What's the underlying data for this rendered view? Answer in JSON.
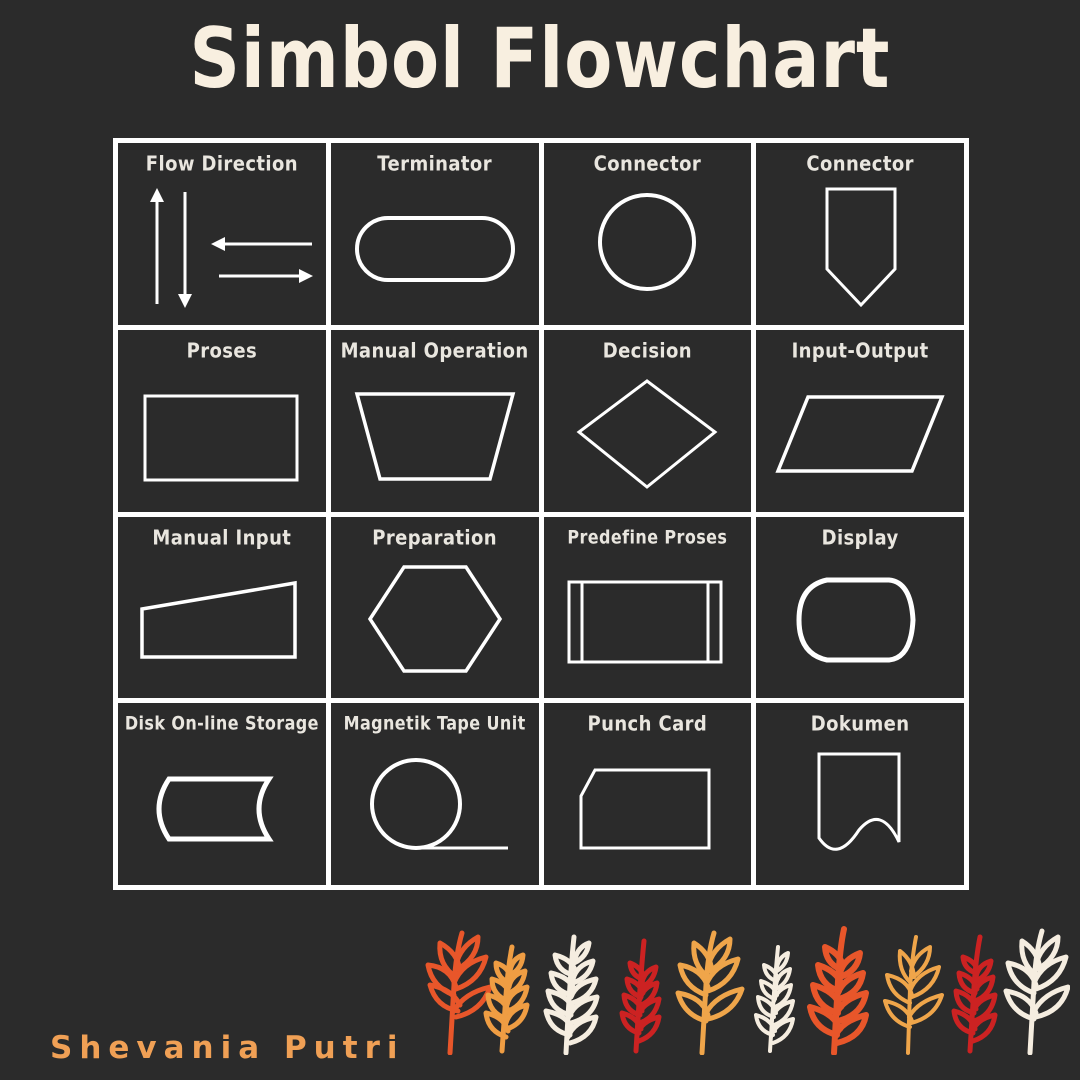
{
  "poster": {
    "title": "Simbol Flowchart",
    "signature": "Shevania Putri",
    "background_color": "#2b2b2b",
    "title_color": "#f8efe0",
    "stroke_color": "#ffffff",
    "label_color": "#e9e6df",
    "signature_color": "#f0a055"
  },
  "grid": {
    "rows": 4,
    "columns": 4,
    "cells": [
      {
        "label": "Flow Direction",
        "symbol": "flow-direction-arrows"
      },
      {
        "label": "Terminator",
        "symbol": "stadium-rounded-rectangle"
      },
      {
        "label": "Connector",
        "symbol": "circle"
      },
      {
        "label": "Connector",
        "symbol": "off-page-connector-pentagon"
      },
      {
        "label": "Proses",
        "symbol": "rectangle"
      },
      {
        "label": "Manual Operation",
        "symbol": "inverted-trapezoid"
      },
      {
        "label": "Decision",
        "symbol": "diamond"
      },
      {
        "label": "Input-Output",
        "symbol": "parallelogram"
      },
      {
        "label": "Manual Input",
        "symbol": "slanted-top-quadrilateral"
      },
      {
        "label": "Preparation",
        "symbol": "hexagon"
      },
      {
        "label": "Predefine Proses",
        "symbol": "rectangle-with-side-bars"
      },
      {
        "label": "Display",
        "symbol": "display-rounded-left"
      },
      {
        "label": "Disk On-line Storage",
        "symbol": "horizontal-cylinder"
      },
      {
        "label": "Magnetik Tape Unit",
        "symbol": "circle-with-tangent-line"
      },
      {
        "label": "Punch Card",
        "symbol": "rectangle-cut-corner"
      },
      {
        "label": "Dokumen",
        "symbol": "document-wavy-bottom"
      }
    ]
  },
  "botanicals": {
    "colors": [
      "#e8562a",
      "#ef9d43",
      "#f5ede0",
      "#cc2222",
      "#efa54a",
      "#f5ede0",
      "#e8562a",
      "#efa54a",
      "#cc2222",
      "#f5ede0"
    ]
  }
}
